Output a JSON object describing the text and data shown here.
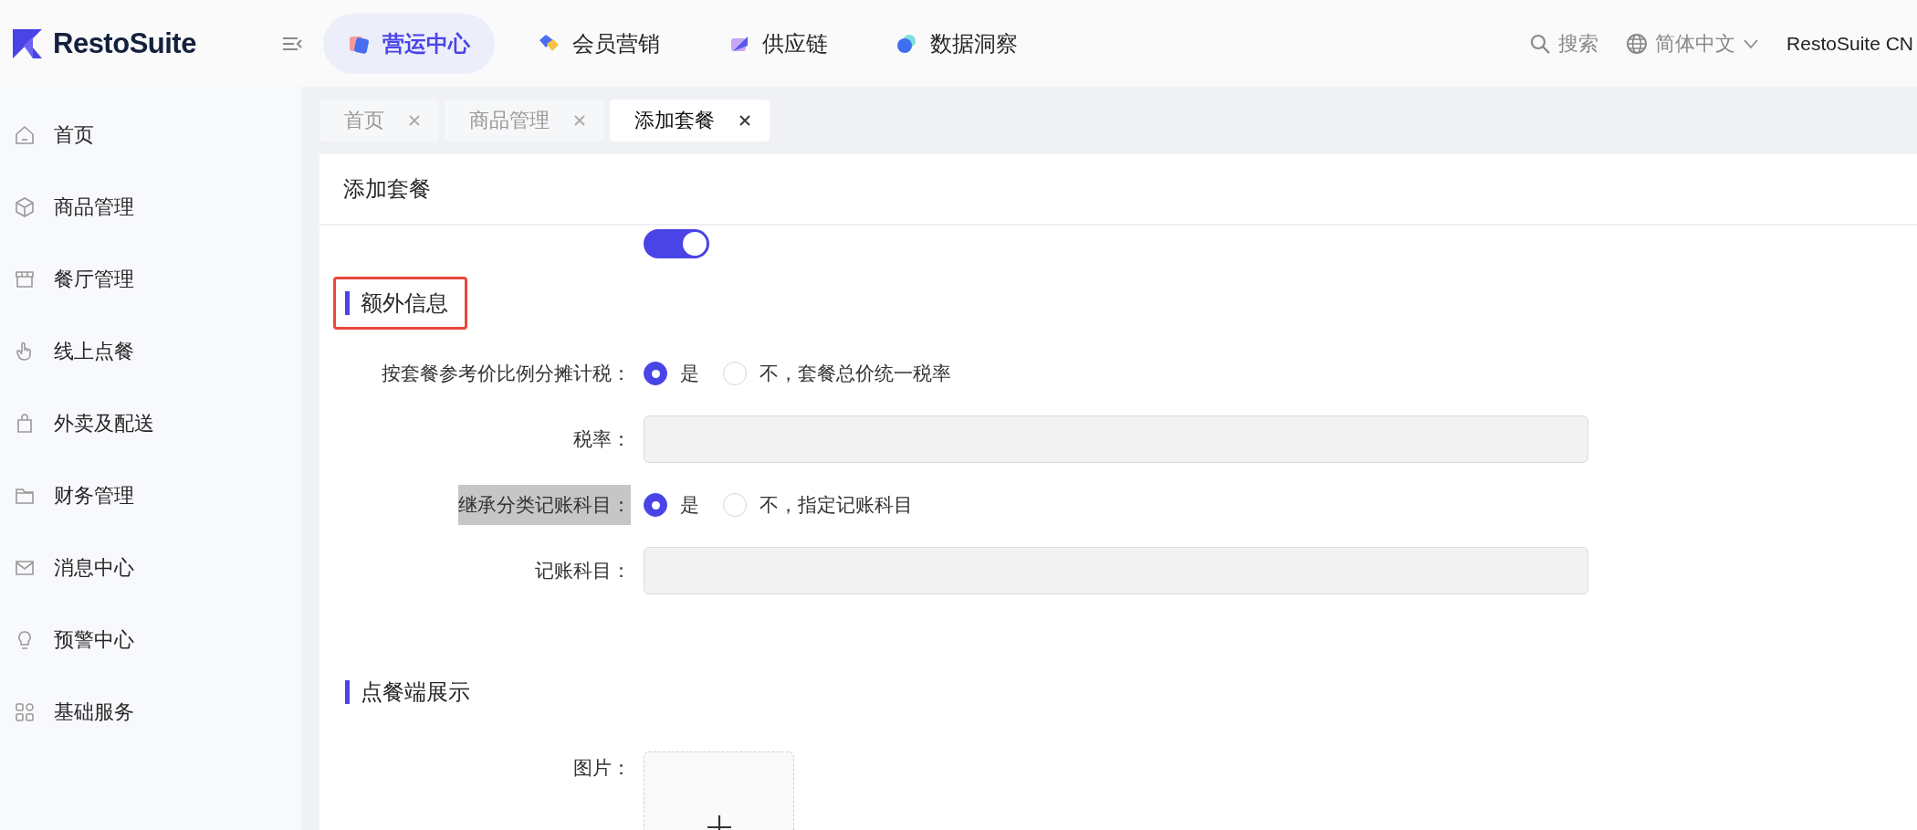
{
  "brand": {
    "name": "RestoSuite"
  },
  "top_nav": [
    {
      "label": "营运中心",
      "selected": true,
      "kind": "ops"
    },
    {
      "label": "会员营销",
      "selected": false,
      "kind": "member"
    },
    {
      "label": "供应链",
      "selected": false,
      "kind": "supply"
    },
    {
      "label": "数据洞察",
      "selected": false,
      "kind": "data"
    }
  ],
  "search": {
    "label": "搜索"
  },
  "language": {
    "label": "简体中文"
  },
  "account": {
    "label": "RestoSuite CN"
  },
  "sidebar": {
    "items": [
      {
        "label": "首页",
        "kind": "home"
      },
      {
        "label": "商品管理",
        "kind": "cube"
      },
      {
        "label": "餐厅管理",
        "kind": "store"
      },
      {
        "label": "线上点餐",
        "kind": "hand"
      },
      {
        "label": "外卖及配送",
        "kind": "bag"
      },
      {
        "label": "财务管理",
        "kind": "folder"
      },
      {
        "label": "消息中心",
        "kind": "mail"
      },
      {
        "label": "预警中心",
        "kind": "bulb"
      },
      {
        "label": "基础服务",
        "kind": "grid"
      }
    ]
  },
  "page_tabs": [
    {
      "label": "首页",
      "selected": false
    },
    {
      "label": "商品管理",
      "selected": false
    },
    {
      "label": "添加套餐",
      "selected": true
    }
  ],
  "card": {
    "title": "添加套餐"
  },
  "toggle": {
    "on": true
  },
  "sections": [
    {
      "title": "额外信息",
      "outlined": true,
      "fields": [
        {
          "kind": "radio",
          "label": "按套餐参考价比例分摊计税：",
          "highlighted": false,
          "options": [
            {
              "label": "是",
              "selected": true
            },
            {
              "label": "不，套餐总价统一税率",
              "selected": false
            }
          ]
        },
        {
          "kind": "input",
          "label": "税率：",
          "disabled": true
        },
        {
          "kind": "radio",
          "label": "继承分类记账科目：",
          "highlighted": true,
          "options": [
            {
              "label": "是",
              "selected": true
            },
            {
              "label": "不，指定记账科目",
              "selected": false
            }
          ]
        },
        {
          "kind": "input",
          "label": "记账科目：",
          "disabled": true
        }
      ]
    },
    {
      "title": "点餐端展示",
      "outlined": false,
      "fields": [
        {
          "kind": "upload",
          "label": "图片："
        }
      ]
    }
  ]
}
